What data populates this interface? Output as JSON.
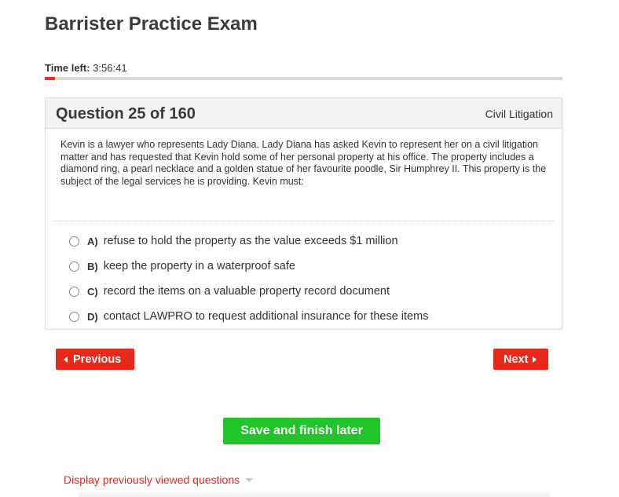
{
  "exam": {
    "title": "Barrister Practice Exam",
    "time_left_label": "Time left:",
    "time_left_value": "3:56:41",
    "progress_fraction": 0.02
  },
  "question": {
    "number_label": "Question 25 of 160",
    "category": "Civil Litigation",
    "text": "Kevin is a lawyer who represents Lady Diana. Lady Diana has asked Kevin to represent her on a civil litigation matter and has requested that Kevin hold some of her personal property at his office. The property includes a diamond ring, a pearl necklace and a golden statue of her favourite poodle, Sir Humphrey II. This property is the subject of the legal services he is providing. Kevin must:",
    "options": [
      {
        "letter": "A)",
        "text": "refuse to hold the property as the value exceeds $1 million"
      },
      {
        "letter": "B)",
        "text": "keep the property in a waterproof safe"
      },
      {
        "letter": "C)",
        "text": "record the items on a valuable property record document"
      },
      {
        "letter": "D)",
        "text": "contact LAWPRO to request additional insurance for these items"
      }
    ]
  },
  "nav": {
    "previous_label": "Previous",
    "next_label": "Next",
    "save_label": "Save and finish later",
    "history_label": "Display previously viewed questions"
  },
  "colors": {
    "accent_red": "#e8281a",
    "save_green": "#21c42a"
  },
  "icons": {
    "previous": "caret-left-icon",
    "next": "caret-right-icon",
    "history": "caret-down-icon"
  }
}
